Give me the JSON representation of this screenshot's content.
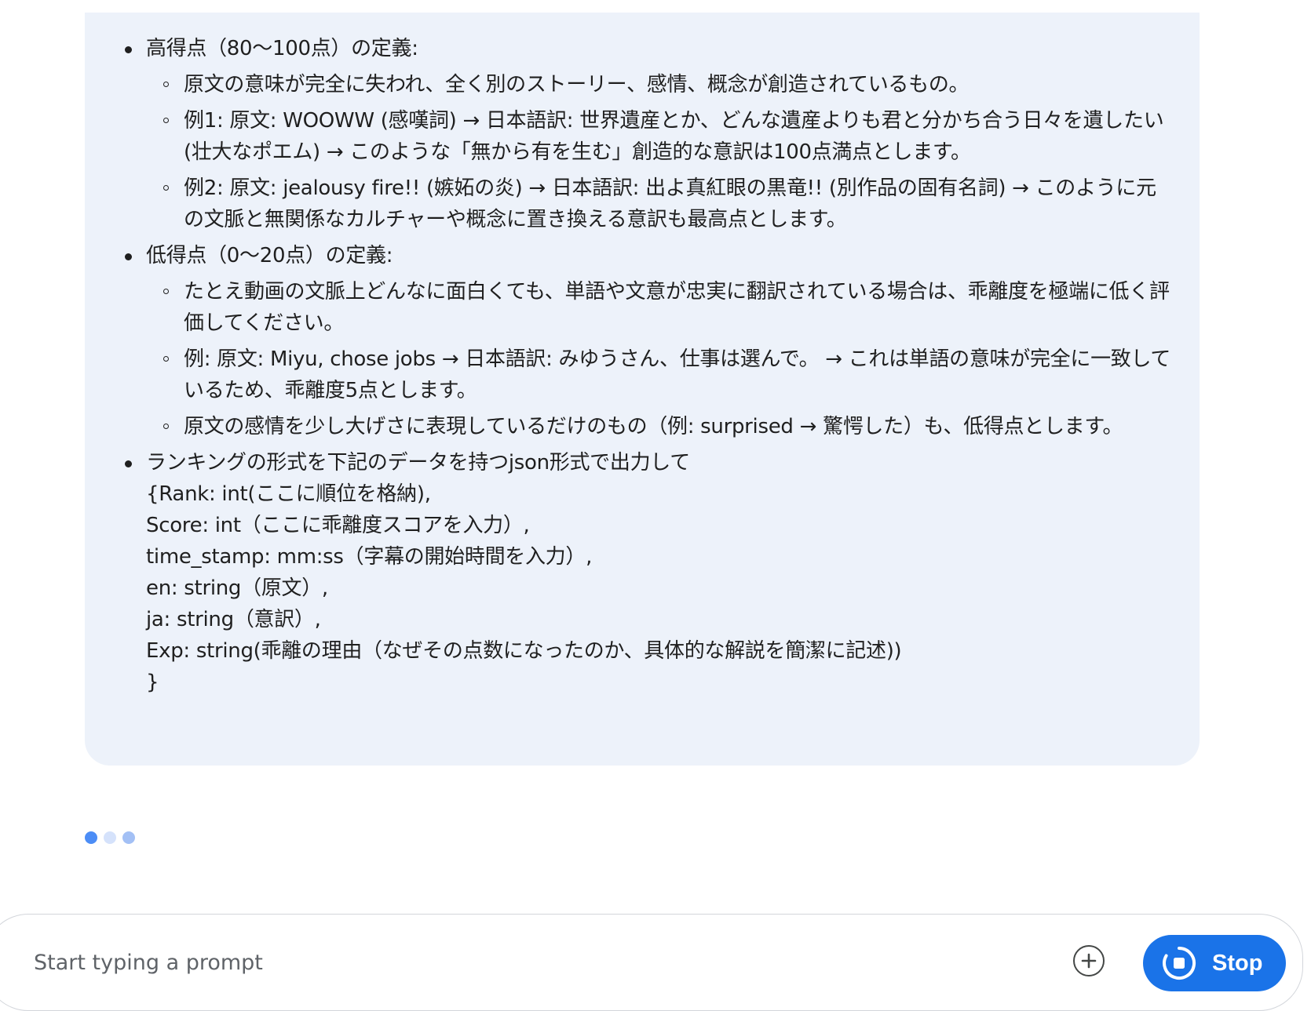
{
  "message": {
    "items": [
      {
        "text": "高得点（80〜100点）の定義:",
        "subitems": [
          "原文の意味が完全に失われ、全く別のストーリー、感情、概念が創造されているもの。",
          "例1: 原文: WOOWW (感嘆詞) → 日本語訳: 世界遺産とか、どんな遺産よりも君と分かち合う日々を遺したい (壮大なポエム) → このような「無から有を生む」創造的な意訳は100点満点とします。",
          "例2: 原文: jealousy fire!! (嫉妬の炎) → 日本語訳: 出よ真紅眼の黒竜!! (別作品の固有名詞) → このように元の文脈と無関係なカルチャーや概念に置き換える意訳も最高点とします。"
        ]
      },
      {
        "text": "低得点（0〜20点）の定義:",
        "subitems": [
          "たとえ動画の文脈上どんなに面白くても、単語や文意が忠実に翻訳されている場合は、乖離度を極端に低く評価してください。",
          "例: 原文: Miyu, chose jobs → 日本語訳: みゆうさん、仕事は選んで。 → これは単語の意味が完全に一致しているため、乖離度5点とします。",
          "原文の感情を少し大げさに表現しているだけのもの（例: surprised → 驚愕した）も、低得点とします。"
        ]
      },
      {
        "text": "ランキングの形式を下記のデータを持つjson形式で出力して",
        "json_lines": [
          "{Rank: int(ここに順位を格納),",
          "Score: int（ここに乖離度スコアを入力）,",
          "time_stamp: mm:ss（字幕の開始時間を入力）,",
          "en: string（原文）,",
          "ja: string（意訳）,",
          "Exp: string(乖離の理由（なぜその点数になったのか、具体的な解説を簡潔に記述))",
          "}"
        ]
      }
    ]
  },
  "loading_indicator": {
    "colors": [
      "#4c8df6",
      "#d5e2fb",
      "#a3c0f5"
    ]
  },
  "prompt": {
    "placeholder": "Start typing a prompt",
    "value": ""
  },
  "add_button": {
    "icon": "plus-circle-icon"
  },
  "stop_button": {
    "label": "Stop",
    "icon": "stop-circle-icon",
    "color": "#1a73e8"
  }
}
